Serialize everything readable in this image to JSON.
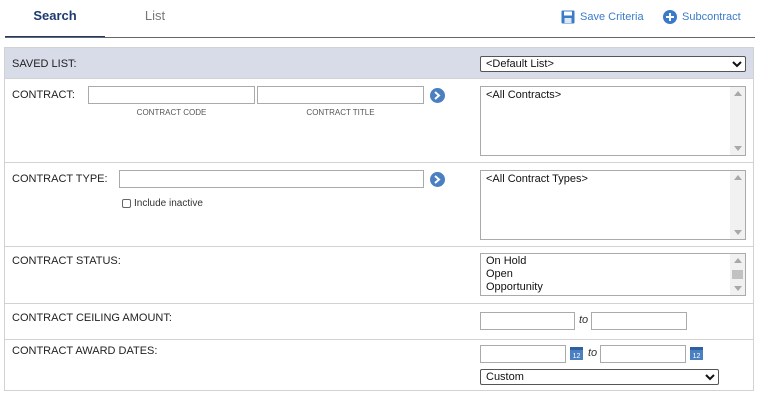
{
  "tabs": {
    "search": "Search",
    "list": "List"
  },
  "actions": {
    "save_criteria": "Save Criteria",
    "subcontract": "Subcontract"
  },
  "saved_list": {
    "label": "SAVED LIST:",
    "selected": "<Default List>"
  },
  "contract": {
    "label": "CONTRACT:",
    "code_value": "",
    "code_sub": "CONTRACT CODE",
    "title_value": "",
    "title_sub": "CONTRACT TITLE",
    "list": [
      "<All Contracts>"
    ]
  },
  "contract_type": {
    "label": "CONTRACT TYPE:",
    "value": "",
    "include_inactive": "Include inactive",
    "list": [
      "<All Contract Types>"
    ]
  },
  "contract_status": {
    "label": "CONTRACT STATUS:",
    "list": [
      "On Hold",
      "Open",
      "Opportunity"
    ]
  },
  "ceiling": {
    "label": "CONTRACT CEILING AMOUNT:",
    "from": "",
    "to_label": "to",
    "to": ""
  },
  "award_dates": {
    "label": "CONTRACT AWARD DATES:",
    "from": "",
    "to_label": "to",
    "to": "",
    "calendar_day": "12",
    "range_selected": "Custom"
  },
  "colors": {
    "accent": "#3a7bc8",
    "tab_active": "#1d3a6e",
    "header_bg": "#d8dbe8",
    "go_button": "#4a7fc1"
  }
}
